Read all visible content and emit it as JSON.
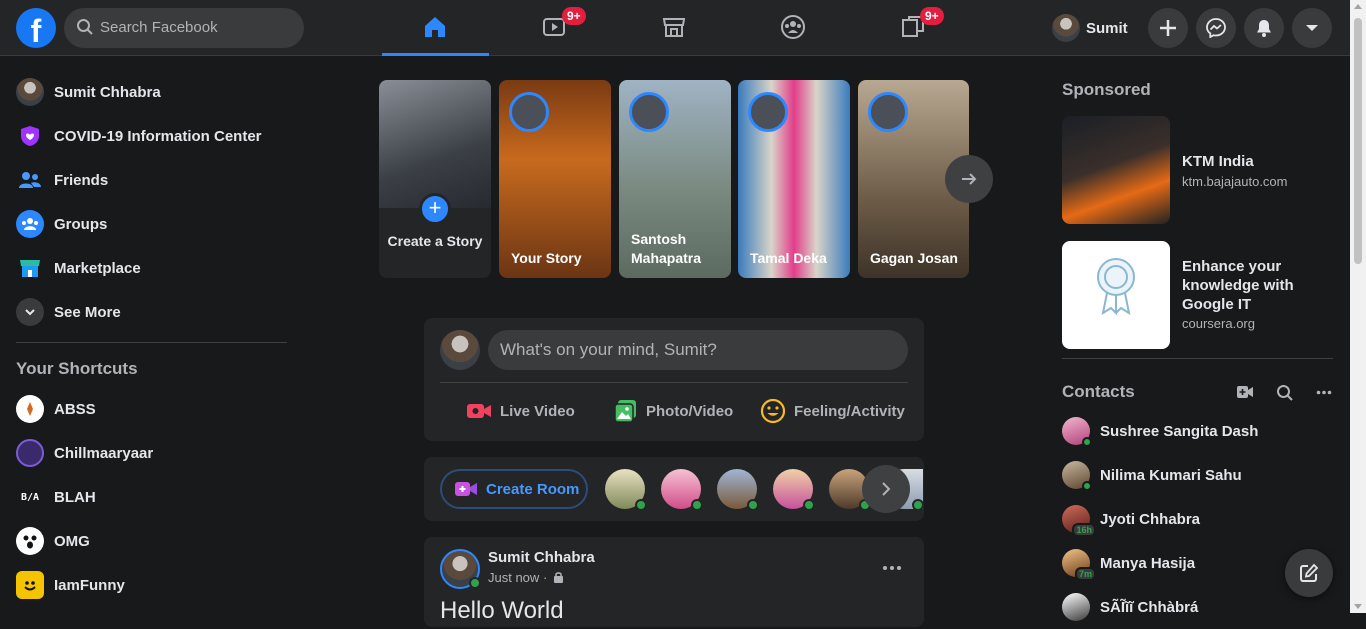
{
  "topbar": {
    "logo": "f",
    "search_placeholder": "Search Facebook",
    "watch_badge": "9+",
    "gaming_badge": "9+",
    "profile_name": "Sumit",
    "icons": [
      "home-icon",
      "watch-icon",
      "marketplace-icon",
      "groups-icon",
      "gaming-icon",
      "create-icon",
      "messenger-icon",
      "notifications-icon",
      "account-icon"
    ]
  },
  "left_nav": {
    "items": [
      {
        "label": "Sumit Chhabra",
        "icon": "avatar"
      },
      {
        "label": "COVID-19 Information Center",
        "icon": "covid-icon"
      },
      {
        "label": "Friends",
        "icon": "friends-icon"
      },
      {
        "label": "Groups",
        "icon": "groups-icon"
      },
      {
        "label": "Marketplace",
        "icon": "marketplace-icon"
      },
      {
        "label": "See More",
        "icon": "chevron-down-icon"
      }
    ],
    "shortcuts_heading": "Your Shortcuts",
    "shortcuts": [
      {
        "label": "ABSS"
      },
      {
        "label": "Chillmaaryaar"
      },
      {
        "label": "BLAH"
      },
      {
        "label": "OMG"
      },
      {
        "label": "IamFunny"
      }
    ]
  },
  "stories": {
    "create_label": "Create a Story",
    "items": [
      {
        "name": "Your Story"
      },
      {
        "name": "Santosh Mahapatra"
      },
      {
        "name": "Tamal Deka"
      },
      {
        "name": "Gagan Josan"
      }
    ]
  },
  "composer": {
    "placeholder": "What's on your mind, Sumit?",
    "actions": [
      {
        "label": "Live Video",
        "color": "#f3425f"
      },
      {
        "label": "Photo/Video",
        "color": "#45bd62"
      },
      {
        "label": "Feeling/Activity",
        "color": "#f7b928"
      }
    ]
  },
  "rooms": {
    "create_room_label": "Create Room"
  },
  "post": {
    "author": "Sumit Chhabra",
    "time": "Just now",
    "privacy_separator": "·",
    "text": "Hello World"
  },
  "sidebar_right": {
    "sponsored_heading": "Sponsored",
    "ads": [
      {
        "title": "KTM India",
        "url": "ktm.bajajauto.com"
      },
      {
        "title": "Enhance your knowledge with Google IT",
        "url": "coursera.org"
      }
    ],
    "contacts_heading": "Contacts",
    "contacts": [
      {
        "name": "Sushree Sangita Dash",
        "status": "online"
      },
      {
        "name": "Nilima Kumari Sahu",
        "status": "online"
      },
      {
        "name": "Jyoti Chhabra",
        "status": "16h"
      },
      {
        "name": "Manya Hasija",
        "status": "7m"
      },
      {
        "name": "SÃĨĩĩ Chhàbrá",
        "status": ""
      }
    ]
  },
  "colors": {
    "accent": "#2d88ff",
    "background": "#18191a",
    "surface": "#242526",
    "online": "#31a24c",
    "badge": "#e41e3f"
  }
}
